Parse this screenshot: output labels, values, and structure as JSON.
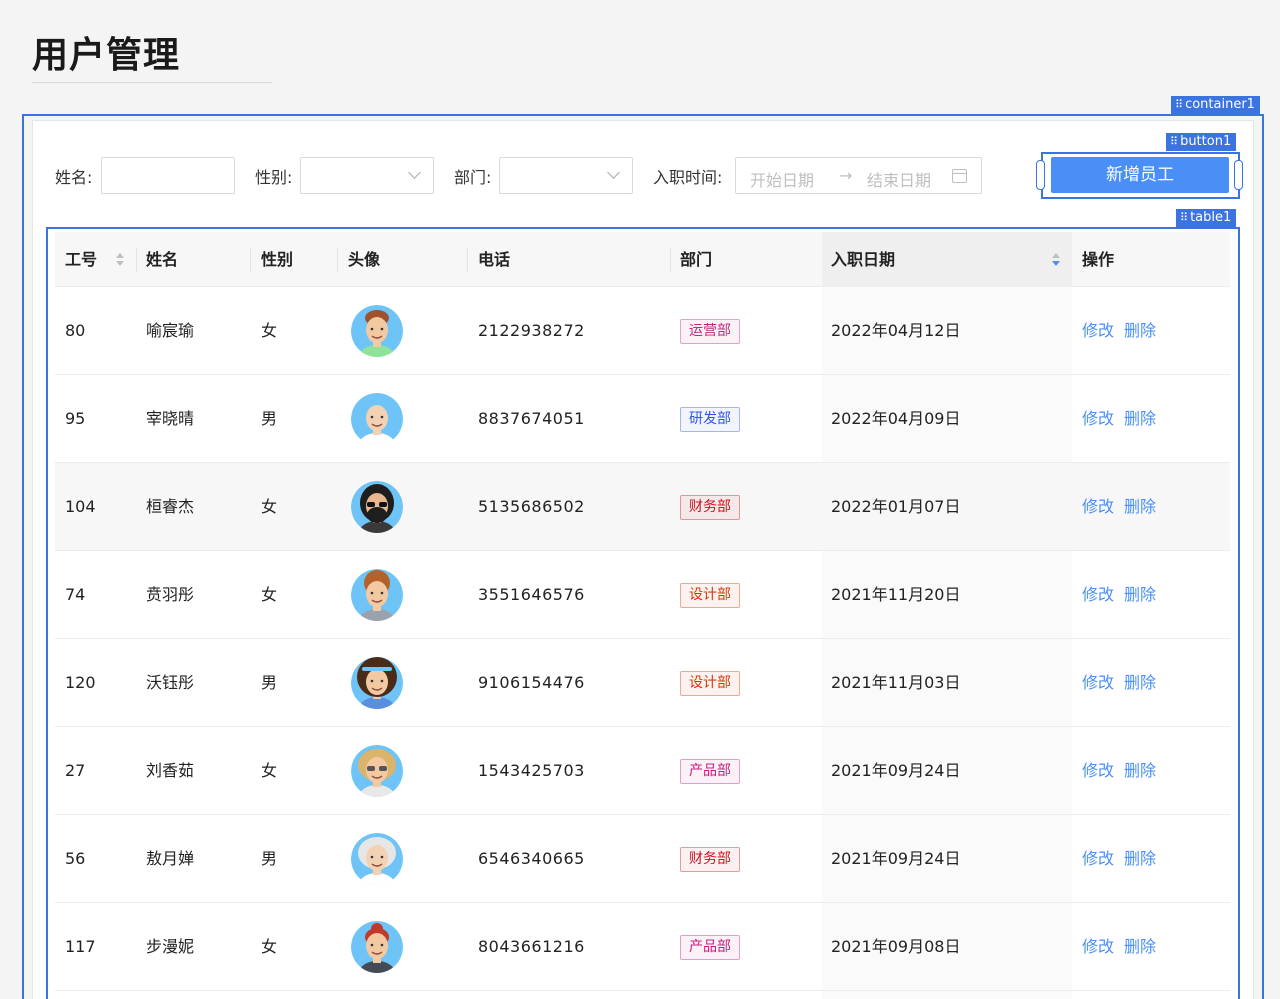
{
  "page": {
    "title": "用户管理"
  },
  "builder": {
    "container_tag": "container1",
    "button_tag": "button1",
    "table_tag": "table1",
    "accent": "#3b73e0"
  },
  "filters": {
    "name_label": "姓名:",
    "gender_label": "性别:",
    "dept_label": "部门:",
    "hire_label": "入职时间:",
    "date_start_placeholder": "开始日期",
    "date_end_placeholder": "结束日期",
    "name_value": "",
    "gender_value": "",
    "dept_value": ""
  },
  "actions": {
    "add_button": "新增员工",
    "add_button_color": "#4a8ff6"
  },
  "table": {
    "columns": [
      "工号",
      "姓名",
      "性别",
      "头像",
      "电话",
      "部门",
      "入职日期",
      "操作"
    ],
    "sort": {
      "column": "入职日期",
      "direction": "descending"
    },
    "edit_label": "修改",
    "delete_label": "删除",
    "rows": [
      {
        "id": "80",
        "name": "喻宸瑜",
        "gender": "女",
        "phone": "2122938272",
        "dept": "运营部",
        "dept_color": "#c0287a",
        "date": "2022年04月12日",
        "avatar": "short-brown-hair-avatar-icon"
      },
      {
        "id": "95",
        "name": "宰晓晴",
        "gender": "男",
        "phone": "8837674051",
        "dept": "研发部",
        "dept_color": "#2f54eb",
        "date": "2022年04月09日",
        "avatar": "bald-avatar-icon"
      },
      {
        "id": "104",
        "name": "桓睿杰",
        "gender": "女",
        "phone": "5135686502",
        "dept": "财务部",
        "dept_color": "#cf1322",
        "date": "2022年01月07日",
        "avatar": "bearded-sunglasses-avatar-icon"
      },
      {
        "id": "74",
        "name": "贲羽彤",
        "gender": "女",
        "phone": "3551646576",
        "dept": "设计部",
        "dept_color": "#d4380d",
        "date": "2021年11月20日",
        "avatar": "curly-red-hair-avatar-icon"
      },
      {
        "id": "120",
        "name": "沃钰彤",
        "gender": "男",
        "phone": "9106154476",
        "dept": "设计部",
        "dept_color": "#d4380d",
        "date": "2021年11月03日",
        "avatar": "afro-headband-avatar-icon"
      },
      {
        "id": "27",
        "name": "刘香茹",
        "gender": "女",
        "phone": "1543425703",
        "dept": "产品部",
        "dept_color": "#c41d7f",
        "date": "2021年09月24日",
        "avatar": "blonde-sunglasses-avatar-icon"
      },
      {
        "id": "56",
        "name": "敖月婵",
        "gender": "男",
        "phone": "6546340665",
        "dept": "财务部",
        "dept_color": "#cf1322",
        "date": "2021年09月24日",
        "avatar": "white-hair-avatar-icon"
      },
      {
        "id": "117",
        "name": "步漫妮",
        "gender": "女",
        "phone": "8043661216",
        "dept": "产品部",
        "dept_color": "#c41d7f",
        "date": "2021年09月08日",
        "avatar": "red-bun-avatar-icon"
      }
    ]
  }
}
